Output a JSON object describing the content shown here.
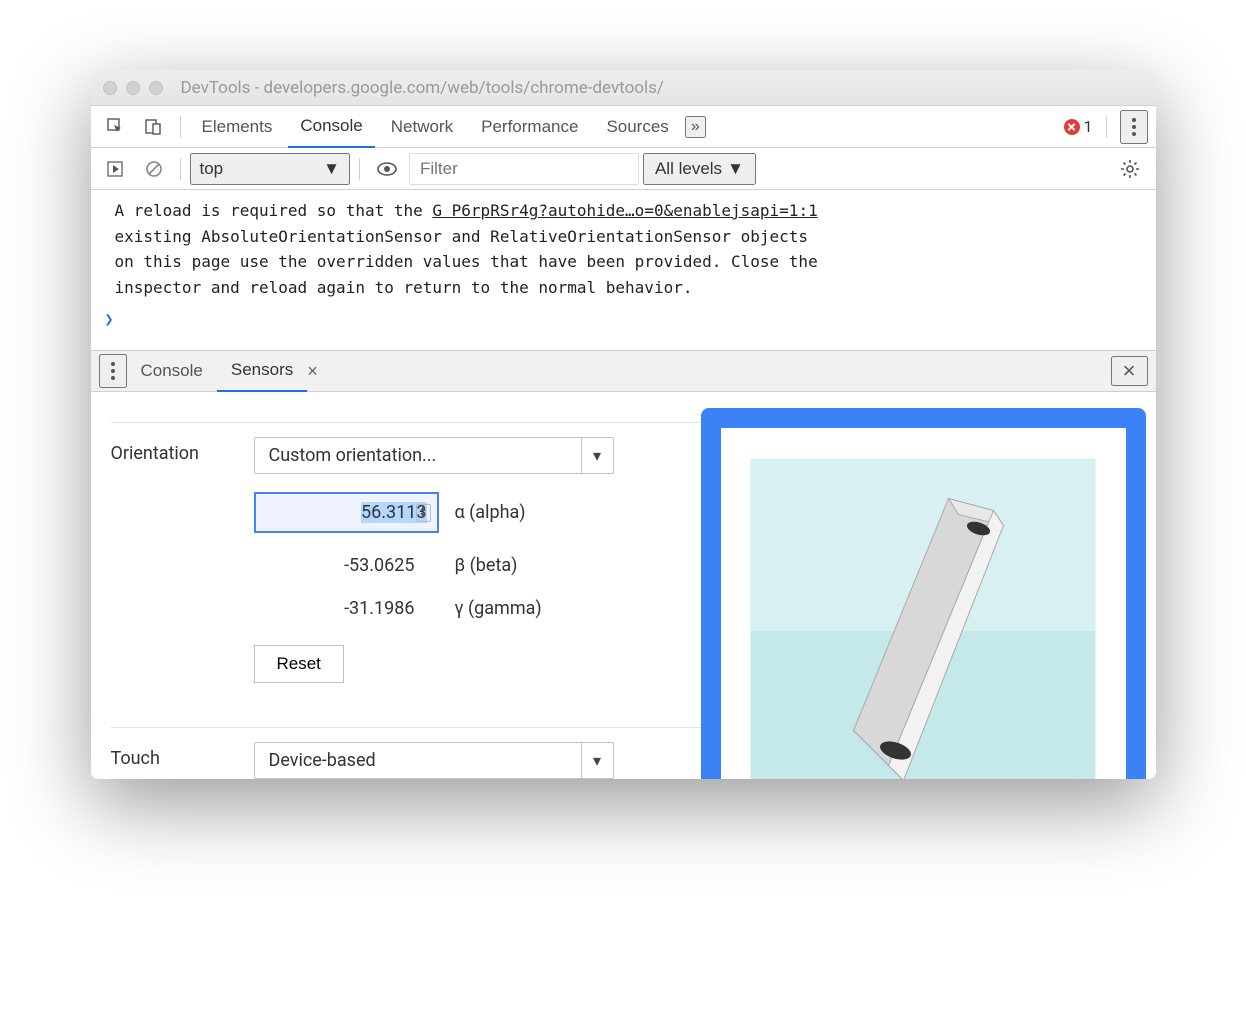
{
  "window": {
    "title": "DevTools - developers.google.com/web/tools/chrome-devtools/"
  },
  "topTabs": {
    "items": [
      "Elements",
      "Console",
      "Network",
      "Performance",
      "Sources"
    ],
    "activeIndex": 1,
    "overflow": "»",
    "errorCount": "1"
  },
  "consoleToolbar": {
    "context": "top",
    "filterPlaceholder": "Filter",
    "levels": "All levels"
  },
  "consoleMessage": {
    "line1a": "A reload is required so that the ",
    "line1link": "G P6rpRSr4g?autohide…o=0&enablejsapi=1:1",
    "line2": "existing AbsoluteOrientationSensor and RelativeOrientationSensor objects",
    "line3": "on this page use the overridden values that have been provided. Close the",
    "line4": "inspector and reload again to return to the normal behavior."
  },
  "drawer": {
    "tabs": [
      "Console",
      "Sensors"
    ],
    "activeIndex": 1
  },
  "sensors": {
    "orientation": {
      "label": "Orientation",
      "preset": "Custom orientation...",
      "alpha": {
        "value": "56.3113",
        "label": "α (alpha)"
      },
      "beta": {
        "value": "-53.0625",
        "label": "β (beta)"
      },
      "gamma": {
        "value": "-31.1986",
        "label": "γ (gamma)"
      },
      "resetLabel": "Reset"
    },
    "touch": {
      "label": "Touch",
      "value": "Device-based"
    }
  }
}
